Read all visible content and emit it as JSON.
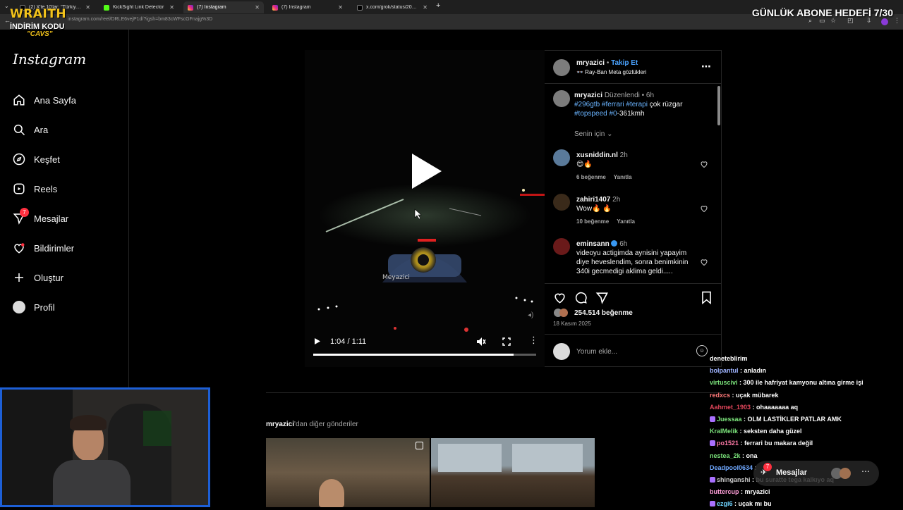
{
  "browser": {
    "tabs": [
      {
        "title": "(2) X'te 10'lar: \"Türkiye'yi ziyare",
        "active": false,
        "favicon": "x-icon"
      },
      {
        "title": "KickSight Link Detector",
        "active": false,
        "favicon": "kick-icon"
      },
      {
        "title": "(7) Instagram",
        "active": true,
        "favicon": "instagram-icon"
      },
      {
        "title": "(7) Instagram",
        "active": false,
        "favicon": "instagram-icon"
      },
      {
        "title": "x.com/grok/status/200704649",
        "active": false,
        "favicon": "x-icon"
      }
    ],
    "new_tab": "+",
    "url": "instagram.com/reel/DRLE6vejP1d/?igsh=bm83cWFscGFnajg%3D"
  },
  "overlay": {
    "brand_line1": "WRAITH",
    "brand_line2": "İNDİRİM KODU",
    "brand_line3": "\"CAVS\"",
    "goal": "GÜNLÜK ABONE HEDEFİ 7/30"
  },
  "sidebar": {
    "logo": "Instagram",
    "items": [
      {
        "label": "Ana Sayfa",
        "icon": "home-icon"
      },
      {
        "label": "Ara",
        "icon": "search-icon"
      },
      {
        "label": "Keşfet",
        "icon": "compass-icon"
      },
      {
        "label": "Reels",
        "icon": "reels-icon"
      },
      {
        "label": "Mesajlar",
        "icon": "messenger-icon",
        "badge": "7"
      },
      {
        "label": "Bildirimler",
        "icon": "heart-icon"
      },
      {
        "label": "Oluştur",
        "icon": "plus-icon"
      },
      {
        "label": "Profil",
        "icon": "profile-avatar"
      }
    ]
  },
  "video": {
    "time": "1:04 / 1:11",
    "progress": 0.9,
    "dash_text": "Meyazici"
  },
  "post": {
    "author": "mryazici",
    "dot": "•",
    "follow": "Takip Et",
    "subtitle": "👓 Ray-Ban Meta gözlükleri",
    "caption_author": "mryazici",
    "caption_edited": "Düzenlendi •",
    "caption_time": "6h",
    "caption_tags1": "#296gtb #ferrari #terapi",
    "caption_text1": " çok rüzgar",
    "caption_tags2": "#topspeed #0",
    "caption_text2": "-361kmh",
    "sort": "Senin için",
    "comments": [
      {
        "user": "xusniddin.nl",
        "time": "2h",
        "text": "😍🔥",
        "likes": "6 beğenme",
        "reply": "Yanıtla"
      },
      {
        "user": "zahiri1407",
        "time": "2h",
        "text": "Wow🔥 🔥",
        "likes": "10 beğenme",
        "reply": "Yanıtla"
      },
      {
        "user": "eminsann",
        "time": "6h",
        "verified": true,
        "text": "videoyu actigimda aynisini yapayim diye heveslendim, sonra benimkinin 340i gecmedigi aklima geldi....."
      }
    ],
    "likes": "254.514 beğenme",
    "date": "18 Kasım 2025",
    "comment_placeholder": "Yorum ekle..."
  },
  "more_posts": {
    "author": "mryazici",
    "suffix": "'dan diğer gönderiler"
  },
  "chat": [
    {
      "user": "",
      "text": "deneteblirim",
      "color": "#ffffff"
    },
    {
      "user": "bolpantul",
      "text": "anladın",
      "color": "#9fb4ff"
    },
    {
      "user": "virtuscivi",
      "text": "300 ile hafriyat kamyonu altına girme işi",
      "color": "#7be37b"
    },
    {
      "user": "redxcs",
      "text": "uçak mübarek",
      "color": "#ff7a7a"
    },
    {
      "user": "Aahmet_1903",
      "text": "ohaaaaaaa aq",
      "color": "#e0455a"
    },
    {
      "user": "Juessaa",
      "text": "OLM LASTİKLER PATLAR AMK",
      "color": "#7be37b",
      "badge": true
    },
    {
      "user": "KralMelik",
      "text": "seksten daha güzel",
      "color": "#7be37b"
    },
    {
      "user": "po1521",
      "text": "ferrari bu makara değil",
      "color": "#ff7aa8",
      "badge": true
    },
    {
      "user": "nestea_2k",
      "text": "ona",
      "color": "#7be37b"
    },
    {
      "user": "Deadpool0634",
      "text": "",
      "color": "#6fa8ff"
    },
    {
      "user": "shinganshi",
      "text": "bu suratte tega kalkıyo aq",
      "color": "#c9c9c9",
      "badge": true
    },
    {
      "user": "buttercup",
      "text": "mryazici",
      "color": "#ff9ed8"
    },
    {
      "user": "ezgi6",
      "text": "uçak mı bu",
      "color": "#6fd3ff",
      "badge": true
    }
  ],
  "messages_pill": {
    "label": "Mesajlar",
    "badge": "7"
  }
}
